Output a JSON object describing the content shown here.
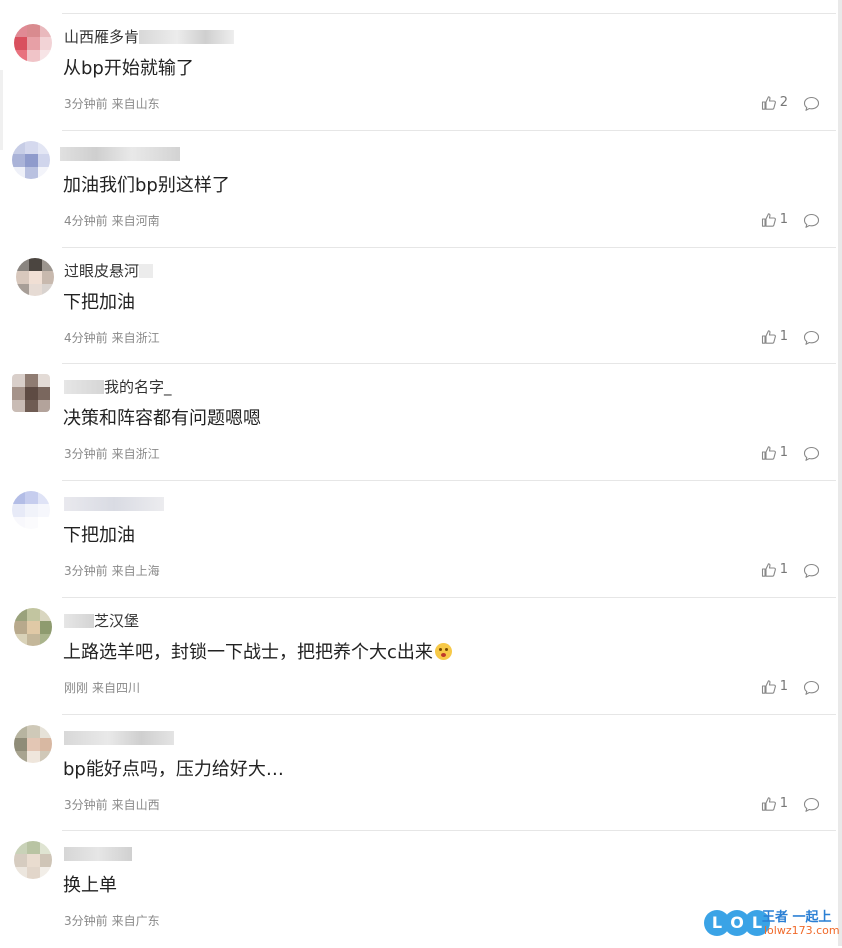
{
  "comments": [
    {
      "nickname": "山西雁多肯",
      "text": "从bp开始就输了",
      "time": "3分钟前",
      "location": "来自山东",
      "likes": "2"
    },
    {
      "nickname": "",
      "text": "加油我们bp别这样了",
      "time": "4分钟前",
      "location": "来自河南",
      "likes": "1"
    },
    {
      "nickname": "过眼皮悬河",
      "text": "下把加油",
      "time": "4分钟前",
      "location": "来自浙江",
      "likes": "1"
    },
    {
      "nickname": "我的名字_",
      "text": "决策和阵容都有问题嗯嗯",
      "time": "3分钟前",
      "location": "来自浙江",
      "likes": "1"
    },
    {
      "nickname": "",
      "text": "下把加油",
      "time": "3分钟前",
      "location": "来自上海",
      "likes": "1"
    },
    {
      "nickname": "芝汉堡",
      "text": "上路选羊吧，封锁一下战士，把把养个大c出来",
      "time": "刚刚",
      "location": "来自四川",
      "likes": "1"
    },
    {
      "nickname": "",
      "text": "bp能好点吗，压力给好大…",
      "time": "3分钟前",
      "location": "来自山西",
      "likes": "1"
    },
    {
      "nickname": "",
      "text": "换上单",
      "time": "3分钟前",
      "location": "来自广东",
      "likes": ""
    }
  ],
  "watermark": {
    "logo_letters": [
      "L",
      "O",
      "L"
    ],
    "slogan": "王者 一起上",
    "url": "lolwz173.com"
  },
  "icons": {
    "like": "thumbs-up-icon",
    "reply": "comment-bubble-icon",
    "emoji": "laughing-tears-emoji-icon"
  },
  "colors": {
    "meta_text": "#8a8a8a",
    "divider": "#e6e6e6",
    "watermark_blue": "#3aa3e6",
    "watermark_orange": "#f06a2a"
  }
}
